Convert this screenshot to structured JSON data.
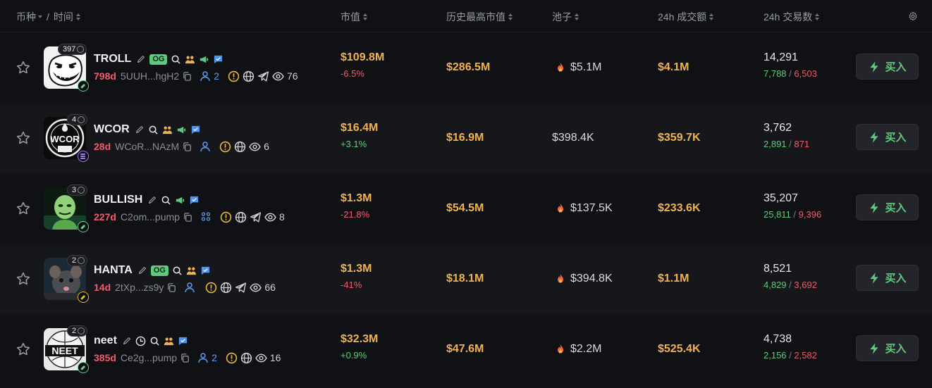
{
  "header": {
    "coin_label": "币种",
    "slash": "/",
    "time_label": "时间",
    "mcap_label": "市值",
    "ath_label": "历史最高市值",
    "pool_label": "池子",
    "vol_label": "24h 成交额",
    "txns_label": "24h 交易数"
  },
  "colors": {
    "positive": "#5fca7e",
    "negative": "#f05c6d",
    "value": "#f3b24e",
    "background": "#101114"
  },
  "rows": [
    {
      "symbol": "TROLL",
      "badge_count": "397",
      "og": "OG",
      "age": "798d",
      "address": "5UUH...hgH2",
      "holders": "2",
      "views": "76",
      "mcap": "$109.8M",
      "change": "-6.5%",
      "ath": "$286.5M",
      "pool": "$5.1M",
      "volume": "$4.1M",
      "txns": "14,291",
      "buys": "7,788",
      "sep": "/",
      "sells": "6,503",
      "buy_label": "买入"
    },
    {
      "symbol": "WCOR",
      "badge_count": "4",
      "age": "28d",
      "address": "WCoR...NAzM",
      "views": "6",
      "mcap": "$16.4M",
      "change": "+3.1%",
      "ath": "$16.9M",
      "pool": "$398.4K",
      "volume": "$359.7K",
      "txns": "3,762",
      "buys": "2,891",
      "sep": "/",
      "sells": "871",
      "buy_label": "买入",
      "avatar_text": "WCOR"
    },
    {
      "symbol": "BULLISH",
      "badge_count": "3",
      "age": "227d",
      "address": "C2om...pump",
      "views": "8",
      "mcap": "$1.3M",
      "change": "-21.8%",
      "ath": "$54.5M",
      "pool": "$137.5K",
      "volume": "$233.6K",
      "txns": "35,207",
      "buys": "25,811",
      "sep": "/",
      "sells": "9,396",
      "buy_label": "买入"
    },
    {
      "symbol": "HANTA",
      "badge_count": "2",
      "og": "OG",
      "age": "14d",
      "address": "2tXp...zs9y",
      "views": "66",
      "mcap": "$1.3M",
      "change": "-41%",
      "ath": "$18.1M",
      "pool": "$394.8K",
      "volume": "$1.1M",
      "txns": "8,521",
      "buys": "4,829",
      "sep": "/",
      "sells": "3,692",
      "buy_label": "买入"
    },
    {
      "symbol": "neet",
      "badge_count": "2",
      "age": "385d",
      "address": "Ce2g...pump",
      "holders": "2",
      "views": "16",
      "mcap": "$32.3M",
      "change": "+0.9%",
      "ath": "$47.6M",
      "pool": "$2.2M",
      "volume": "$525.4K",
      "txns": "4,738",
      "buys": "2,156",
      "sep": "/",
      "sells": "2,582",
      "buy_label": "买入",
      "avatar_text": "NEET"
    }
  ]
}
